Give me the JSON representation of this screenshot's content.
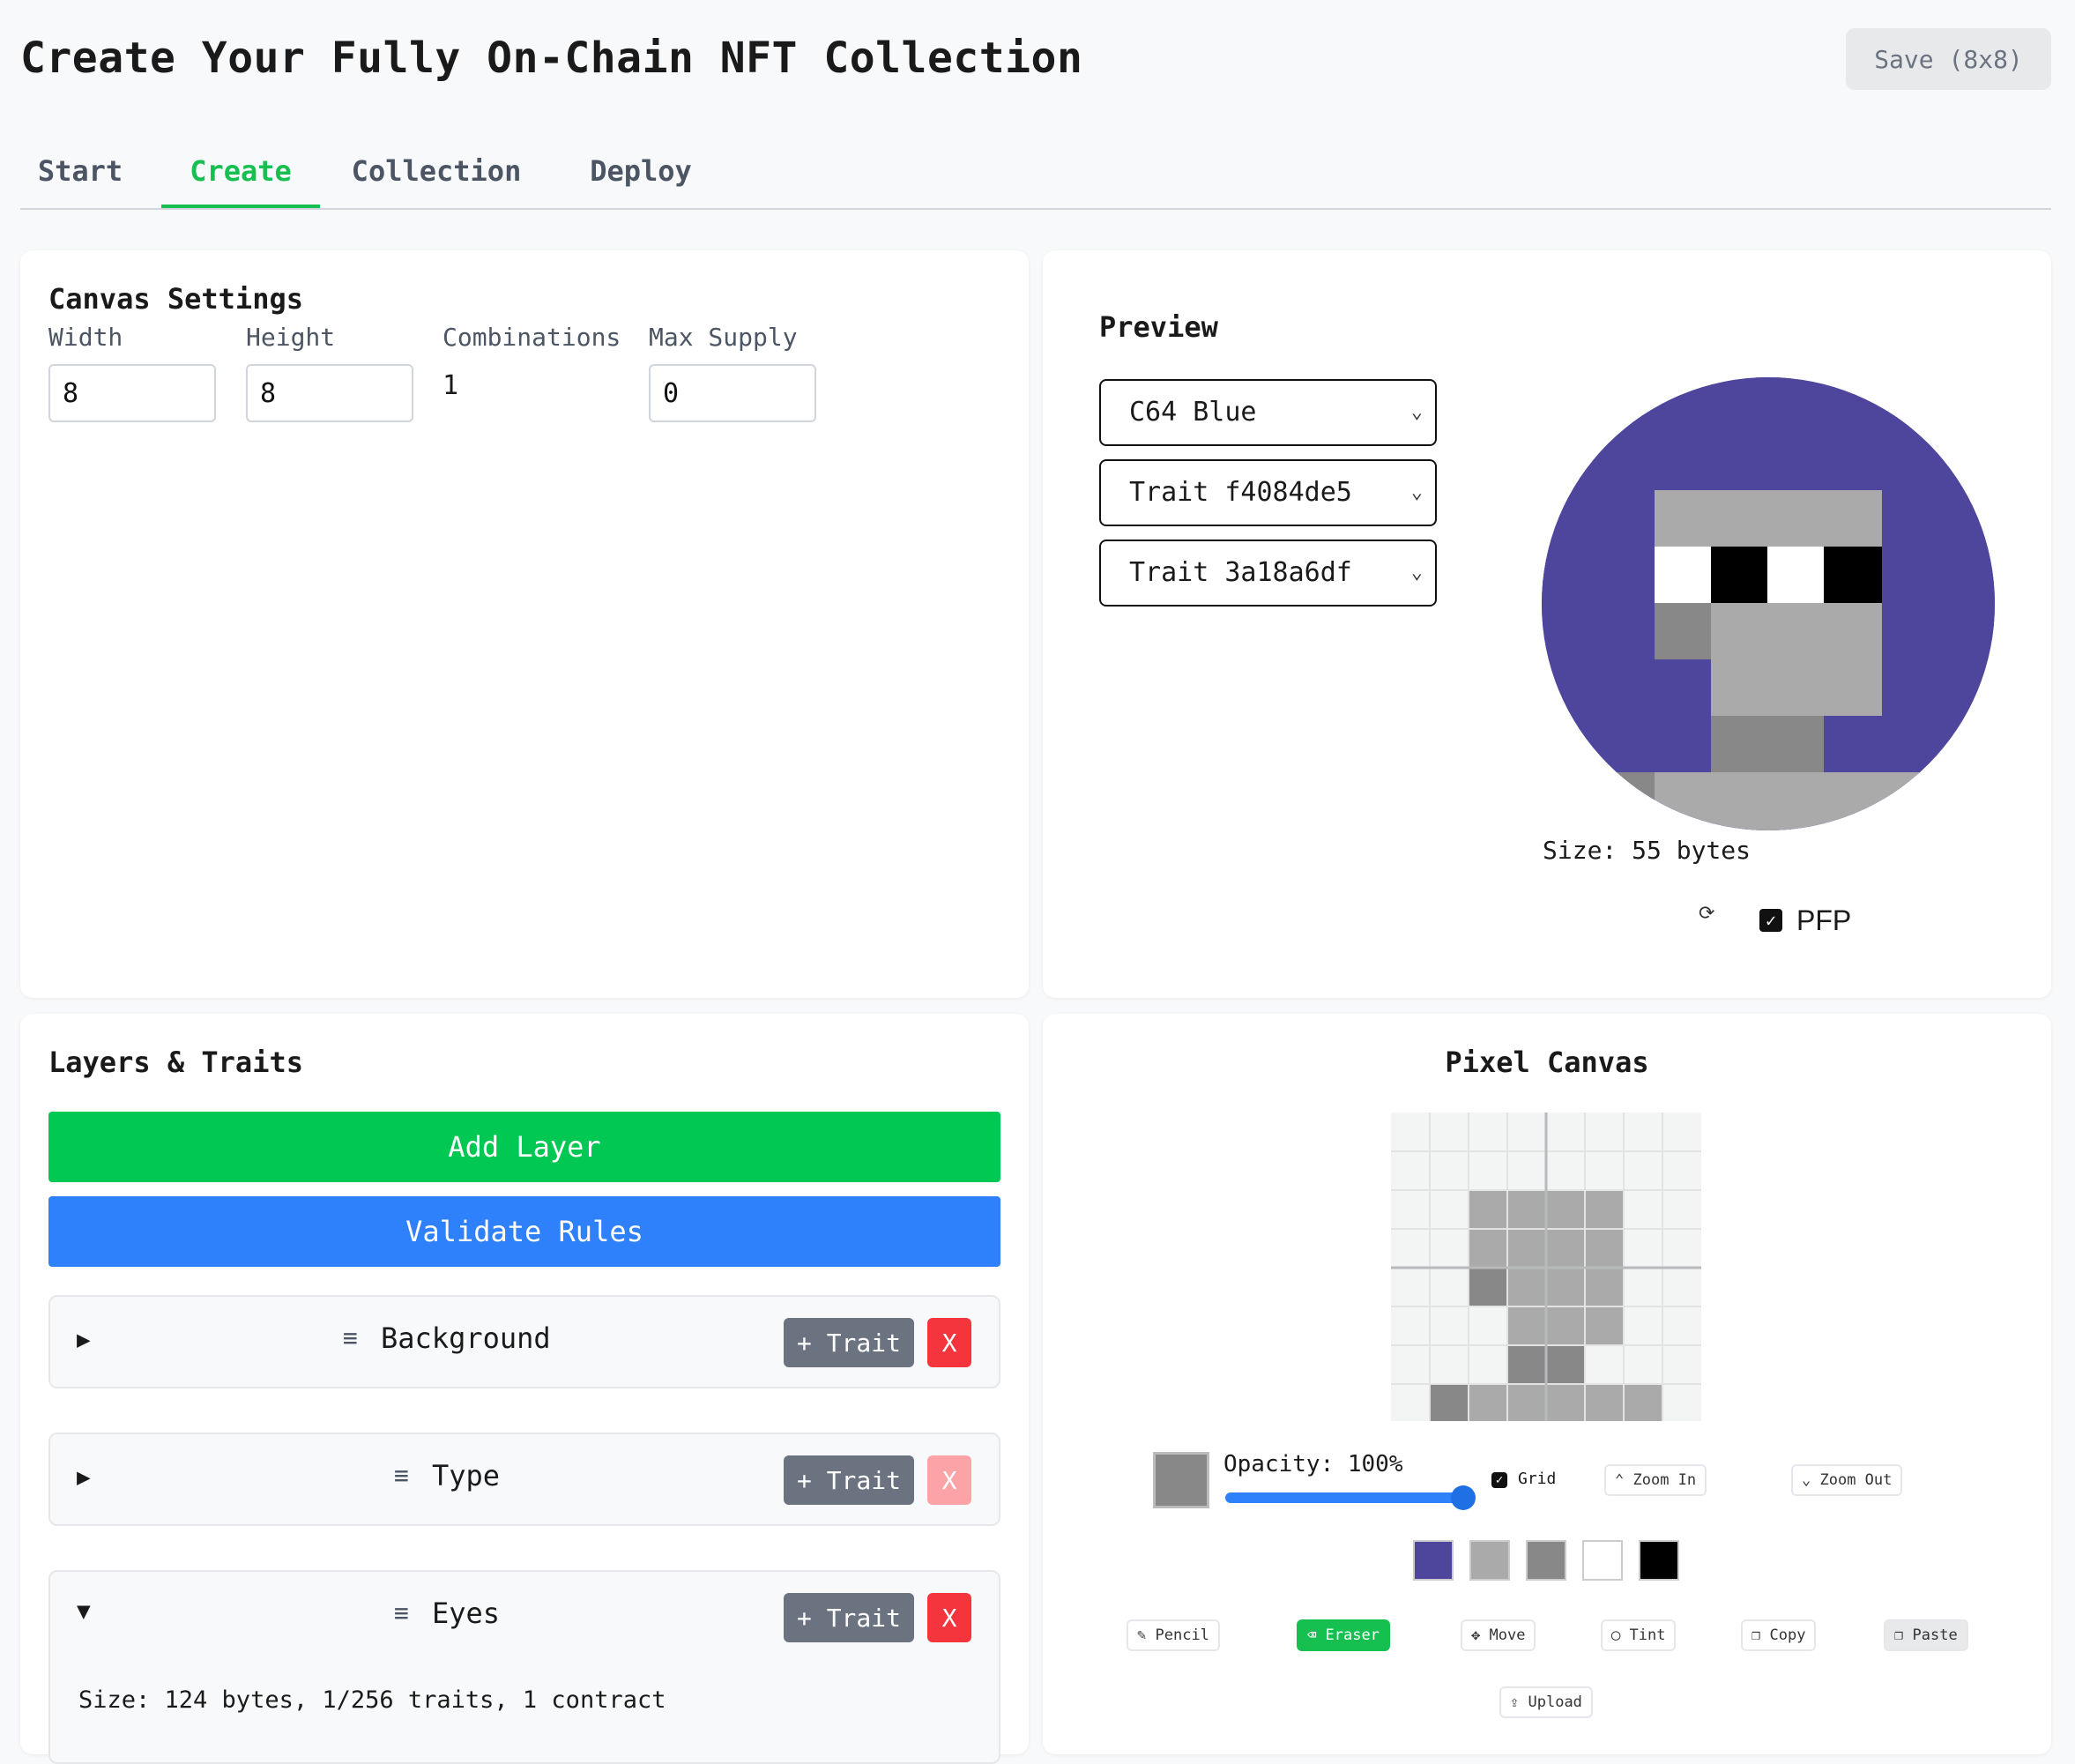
{
  "header": {
    "title": "Create Your Fully On-Chain NFT Collection",
    "save_label": "Save (8x8)"
  },
  "tabs": [
    "Start",
    "Create",
    "Collection",
    "Deploy"
  ],
  "canvas_settings": {
    "title": "Canvas Settings",
    "width_label": "Width",
    "width_value": "8",
    "height_label": "Height",
    "height_value": "8",
    "combinations_label": "Combinations",
    "combinations_value": "1",
    "max_supply_label": "Max Supply",
    "max_supply_value": "0"
  },
  "preview": {
    "title": "Preview",
    "selects": [
      "C64 Blue",
      "Trait f4084de5",
      "Trait 3a18a6df"
    ],
    "size_text": "Size: 55 bytes",
    "pfp_label": "PFP",
    "pfp_checked": true
  },
  "layers": {
    "title": "Layers & Traits",
    "add_layer": "Add Layer",
    "validate_rules": "Validate Rules",
    "trait_button": "+ Trait",
    "remove_button": "X",
    "items": [
      {
        "name": "Background",
        "expanded": false
      },
      {
        "name": "Type",
        "expanded": false
      },
      {
        "name": "Eyes",
        "expanded": true
      }
    ],
    "size_summary": "Size: 124 bytes, 1/256 traits, 1 contract"
  },
  "pixel_canvas": {
    "title": "Pixel Canvas",
    "opacity_label": "Opacity: 100%",
    "opacity_value": 1.0,
    "grid_label": "Grid",
    "zoom_in": "Zoom In",
    "zoom_out": "Zoom Out",
    "palette": [
      "#4e469c",
      "#aaaaaa",
      "#888888",
      "#ffffff",
      "#000000"
    ],
    "tools": [
      "Pencil",
      "Eraser",
      "Move",
      "Tint",
      "Copy",
      "Paste"
    ],
    "active_tool": "Eraser",
    "upload": "Upload",
    "current_color": "#888888"
  },
  "colors": {
    "accent_green": "#16c050",
    "accent_blue": "#2f80fb",
    "danger": "#f5353e",
    "c64_blue": "#4e469c"
  }
}
